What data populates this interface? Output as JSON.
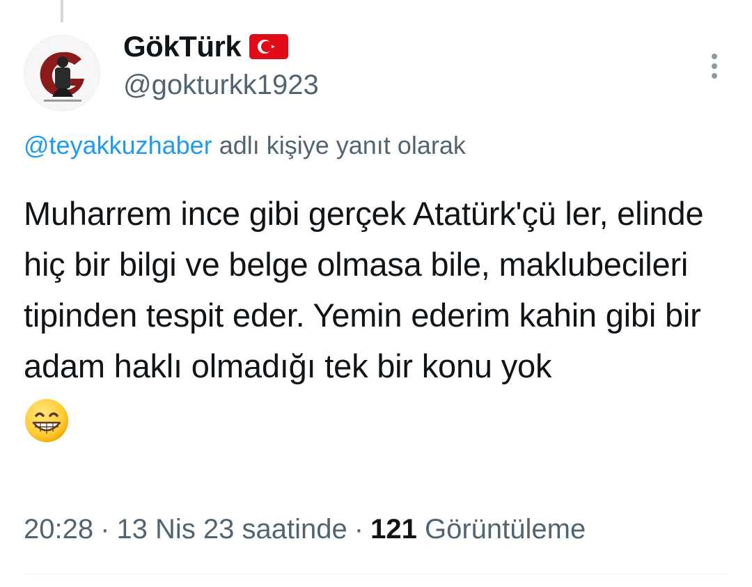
{
  "author": {
    "display_name": "GökTürk",
    "username": "@gokturkk1923",
    "flag_icon": "turkey-flag-icon"
  },
  "reply": {
    "mention": "@teyakkuzhaber",
    "suffix": " adlı kişiye yanıt olarak"
  },
  "tweet": {
    "text": "Muharrem ince gibi gerçek Atatürk'çü ler, elinde hiç bir bilgi ve belge olmasa bile, maklubecileri tipinden tespit eder. Yemin ederim kahin gibi bir adam haklı olmadığı tek bir konu yok",
    "emoji": "grinning-face-emoji"
  },
  "meta": {
    "time": "20:28",
    "separator": "·",
    "date_text": "13 Nis 23 saatinde",
    "views_count": "121",
    "views_label": "Görüntüleme"
  },
  "colors": {
    "accent": "#1d9bf0",
    "secondary_text": "#536471",
    "primary_text": "#0f1419",
    "flag_red": "#e30a17"
  }
}
